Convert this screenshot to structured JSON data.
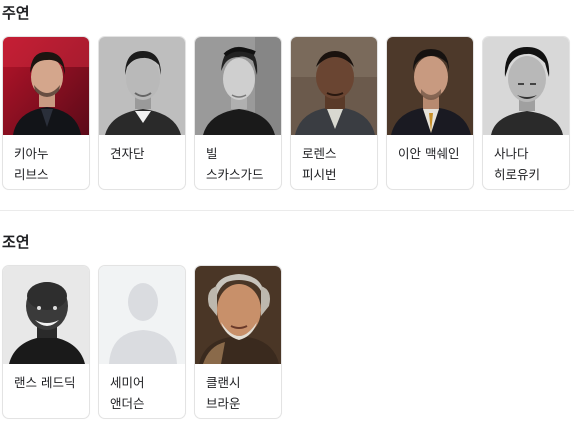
{
  "sections": [
    {
      "title": "주연",
      "people": [
        {
          "name": "키아누 리브스",
          "icon": "person-photo"
        },
        {
          "name": "견자단",
          "icon": "person-photo"
        },
        {
          "name": "빌 스카스가드",
          "icon": "person-photo"
        },
        {
          "name": "로렌스 피시번",
          "icon": "person-photo"
        },
        {
          "name": "이안 맥쉐인",
          "icon": "person-photo"
        },
        {
          "name": "사나다 히로유키",
          "icon": "person-photo"
        }
      ]
    },
    {
      "title": "조연",
      "people": [
        {
          "name": "랜스 레드딕",
          "icon": "person-photo"
        },
        {
          "name": "세미어 앤더슨",
          "icon": "person-placeholder-icon"
        },
        {
          "name": "클랜시 브라운",
          "icon": "person-photo"
        }
      ]
    }
  ]
}
